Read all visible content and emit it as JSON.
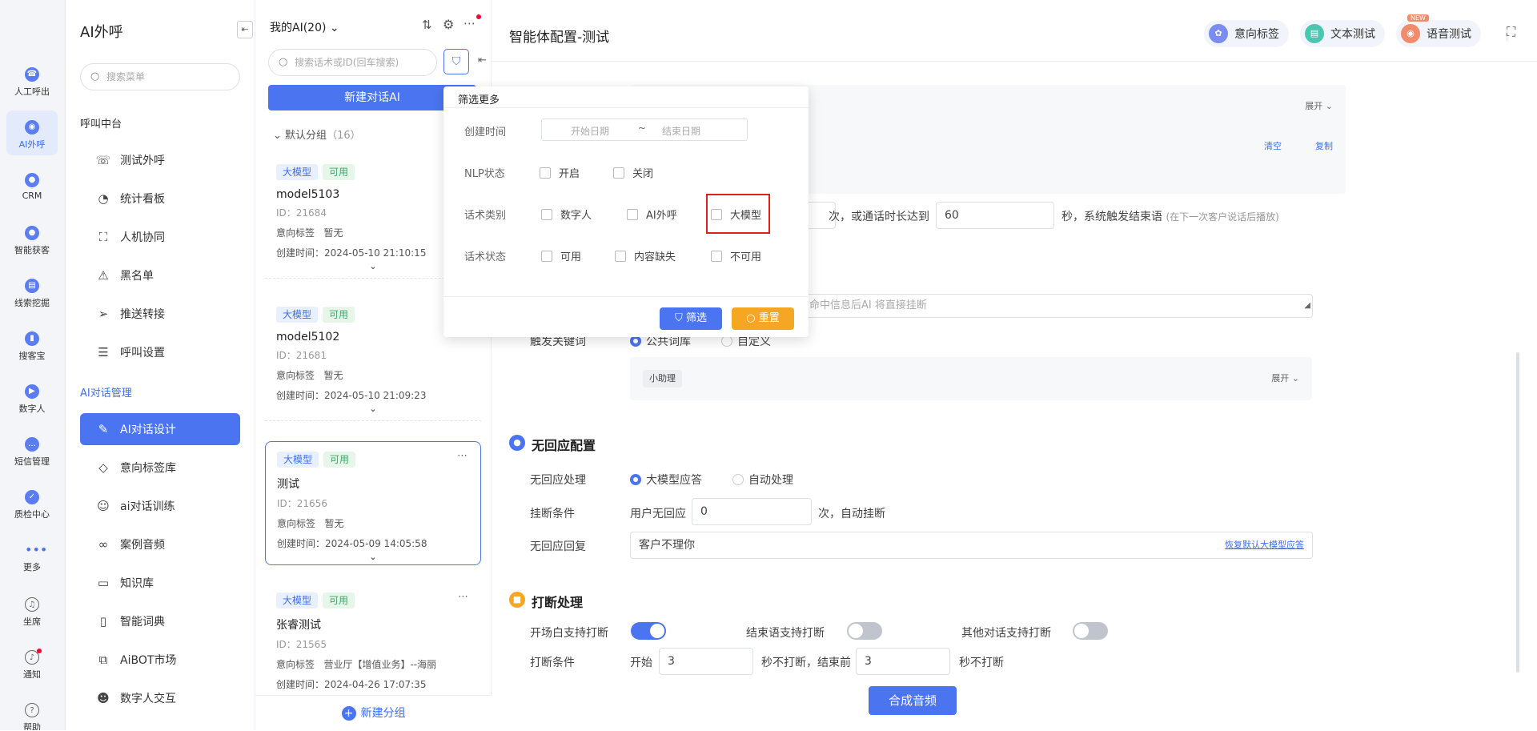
{
  "rail": [
    {
      "label": "人工呼出",
      "icon": "phone-out-icon"
    },
    {
      "label": "AI外呼",
      "icon": "ai-call-icon"
    },
    {
      "label": "CRM",
      "icon": "crm-icon"
    },
    {
      "label": "智能获客",
      "icon": "acquire-icon"
    },
    {
      "label": "线索挖掘",
      "icon": "clue-icon"
    },
    {
      "label": "搜客宝",
      "icon": "search-customer-icon"
    },
    {
      "label": "数字人",
      "icon": "digital-human-icon"
    },
    {
      "label": "短信管理",
      "icon": "sms-icon"
    },
    {
      "label": "质检中心",
      "icon": "quality-icon"
    },
    {
      "label": "更多",
      "icon": "more-icon"
    },
    {
      "label": "坐席",
      "icon": "headset-icon"
    },
    {
      "label": "通知",
      "icon": "bell-icon"
    },
    {
      "label": "帮助",
      "icon": "help-icon"
    }
  ],
  "menu": {
    "title": "AI外呼",
    "search_placeholder": "搜索菜单",
    "group1": "呼叫中台",
    "items1": [
      {
        "label": "测试外呼",
        "icon": "phone-icon"
      },
      {
        "label": "统计看板",
        "icon": "chart-pie-icon"
      },
      {
        "label": "人机协同",
        "icon": "collab-icon"
      },
      {
        "label": "黑名单",
        "icon": "warning-icon"
      },
      {
        "label": "推送转接",
        "icon": "send-icon"
      },
      {
        "label": "呼叫设置",
        "icon": "sliders-icon"
      }
    ],
    "group2": "AI对话管理",
    "items2": [
      {
        "label": "AI对话设计",
        "icon": "pen-icon"
      },
      {
        "label": "意向标签库",
        "icon": "tag-icon"
      },
      {
        "label": "ai对话训练",
        "icon": "chat-icon"
      },
      {
        "label": "案例音频",
        "icon": "tape-icon"
      },
      {
        "label": "知识库",
        "icon": "laptop-icon"
      },
      {
        "label": "智能词典",
        "icon": "book-icon"
      },
      {
        "label": "AiBOT市场",
        "icon": "market-icon"
      },
      {
        "label": "数字人交互",
        "icon": "robot-icon"
      }
    ]
  },
  "list": {
    "title": "我的AI(20)",
    "search_placeholder": "搜索话术或ID(回车搜索)",
    "new_button": "新建对话AI",
    "group": "默认分组",
    "group_count": "（16）",
    "new_group": "新建分组",
    "cards": [
      {
        "badge1": "大模型",
        "badge2": "可用",
        "name": "model5103",
        "id": "ID：21684",
        "intent_label": "意向标签",
        "intent": "暂无",
        "created": "创建时间：2024-05-10 21:10:15"
      },
      {
        "badge1": "大模型",
        "badge2": "可用",
        "name": "model5102",
        "id": "ID：21681",
        "intent_label": "意向标签",
        "intent": "暂无",
        "created": "创建时间：2024-05-10 21:09:23"
      },
      {
        "badge1": "大模型",
        "badge2": "可用",
        "name": "测试",
        "id": "ID：21656",
        "intent_label": "意向标签",
        "intent": "暂无",
        "created": "创建时间：2024-05-09 14:05:58"
      },
      {
        "badge1": "大模型",
        "badge2": "可用",
        "name": "张睿测试",
        "id": "ID：21565",
        "intent_label": "意向标签",
        "intent": "营业厅【增值业务】--海丽",
        "created": "创建时间：2024-04-26 17:07:35"
      }
    ]
  },
  "header": {
    "title": "智能体配置-测试",
    "pills": [
      {
        "label": "意向标签",
        "color": "#7a8cf0"
      },
      {
        "label": "文本测试",
        "color": "#4cc6b0"
      },
      {
        "label": "语音测试",
        "color": "#f08c6c"
      }
    ],
    "voice_badge": "NEW"
  },
  "form": {
    "expand": "展开",
    "clear": "清空",
    "copy": "复制",
    "times_text": "次，或通话时长达到",
    "duration": "60",
    "seconds_text": "秒，系统触发结束语",
    "hint": "(在下一次客户说话后播放)",
    "hangup_placeholder": "命中信息后AI 将直接挂断",
    "trigger_label": "触发关键词",
    "trigger_public": "公共词库",
    "trigger_custom": "自定义",
    "tag": "小助理",
    "noresp_title": "无回应配置",
    "noresp_handle_label": "无回应处理",
    "noresp_opt1": "大模型应答",
    "noresp_opt2": "自动处理",
    "hang_label": "挂断条件",
    "hang_text1": "用户无回应",
    "hang_count": "0",
    "hang_text2": "次，自动挂断",
    "reply_label": "无回应回复",
    "reply_value": "客户不理你",
    "reply_restore": "恢复默认大模型应答",
    "interrupt_title": "打断处理",
    "open_interrupt": "开场白支持打断",
    "end_interrupt": "结束语支持打断",
    "other_interrupt": "其他对话支持打断",
    "cond_label": "打断条件",
    "cond_start": "开始",
    "cond_start_val": "3",
    "cond_mid": "秒不打断，结束前",
    "cond_end_val": "3",
    "cond_end": "秒不打断",
    "synth_button": "合成音频"
  },
  "popup": {
    "title": "筛选更多",
    "created_label": "创建时间",
    "start_placeholder": "开始日期",
    "tilde": "~",
    "end_placeholder": "结束日期",
    "nlp_label": "NLP状态",
    "nlp_opts": [
      "开启",
      "关闭"
    ],
    "cat_label": "话术类别",
    "cat_opts": [
      "数字人",
      "AI外呼",
      "大模型"
    ],
    "status_label": "话术状态",
    "status_opts": [
      "可用",
      "内容缺失",
      "不可用"
    ],
    "filter_button": "筛选",
    "reset_button": "重置",
    "highlight_color": "#e02020"
  },
  "colors": {
    "primary": "#4b74f0",
    "orange": "#f5a623"
  }
}
